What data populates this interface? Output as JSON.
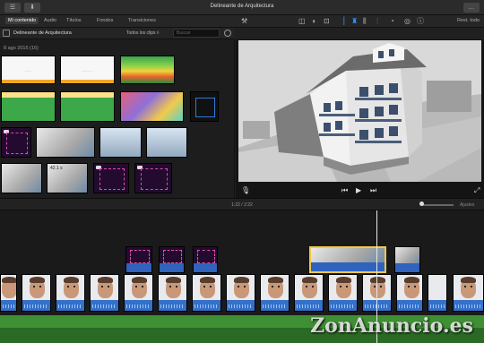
{
  "window": {
    "title": "Delineante de Arquitectura"
  },
  "toolbar": {
    "tabs": [
      {
        "label": "Mi contenido",
        "active": true
      },
      {
        "label": "Audio"
      },
      {
        "label": "Títulos"
      },
      {
        "label": "Fondos"
      },
      {
        "label": "Transiciones"
      }
    ]
  },
  "library": {
    "title": "Delineante de Arquitectura",
    "clip_filter": "Todos los clips ◊",
    "search_placeholder": "Buscar",
    "event_date": "8 ago 2016  (16)",
    "thumb_label": "42.1 s"
  },
  "viewer": {
    "reset_label": "Rest. todo"
  },
  "timeline": {
    "timecode": "1:22  /  2:22",
    "settings_label": "Ajustes"
  },
  "watermark": "ZonAnuncio.es",
  "colors": {
    "accent": "#3c8ef7",
    "selected_clip": "#f3c84a",
    "audio_track": "#3570c9",
    "music_track": "#3f8f35"
  }
}
